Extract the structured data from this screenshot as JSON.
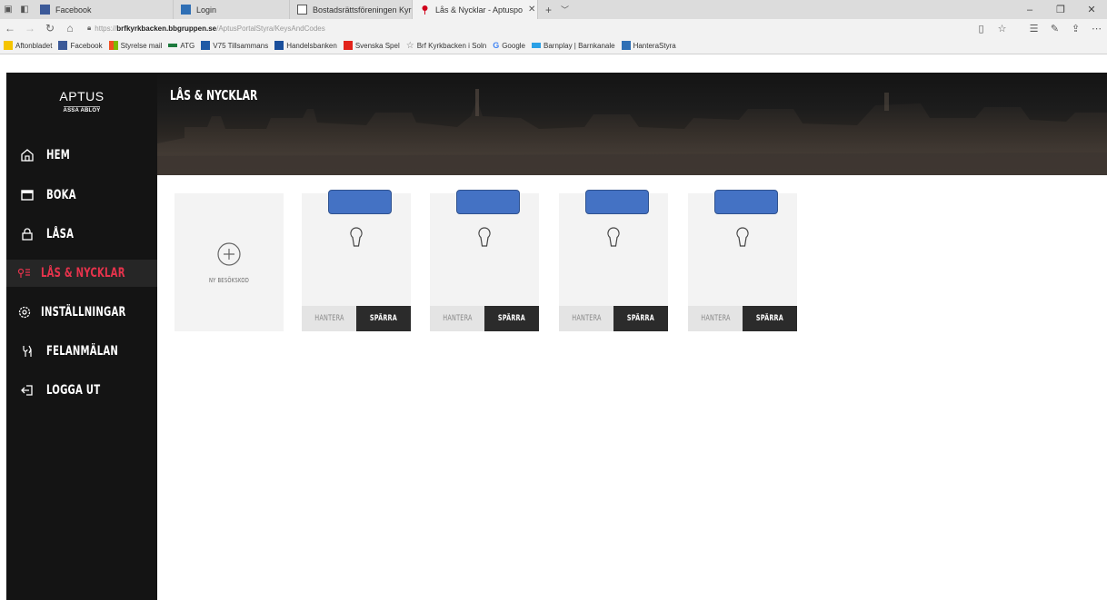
{
  "browser": {
    "tabs": [
      {
        "title": "Facebook",
        "icon": "facebook-icon",
        "color": "#3b5998",
        "active": false
      },
      {
        "title": "Login",
        "icon": "aptus-icon",
        "color": "#2f6fb5",
        "active": false
      },
      {
        "title": "Bostadsrättsföreningen Kyrl",
        "icon": "document-icon",
        "color": "#555555",
        "active": false
      },
      {
        "title": "Lås & Nycklar - Aptuspo",
        "icon": "pin-icon",
        "color": "#d0021b",
        "active": true
      }
    ],
    "url_prefix": "https://",
    "url_host": "brfkyrkbacken.bbgruppen.se",
    "url_path": "/AptusPortalStyra/KeysAndCodes",
    "bookmarks": [
      {
        "label": "Aftonbladet",
        "color": "#f5c400"
      },
      {
        "label": "Facebook",
        "color": "#3b5998"
      },
      {
        "label": "Styrelse mail",
        "color": "#f25022"
      },
      {
        "label": "ATG",
        "color": "#1d7a3d"
      },
      {
        "label": "V75 Tillsammans",
        "color": "#1f5aa6"
      },
      {
        "label": "Handelsbanken",
        "color": "#1a4f9c"
      },
      {
        "label": "Svenska Spel",
        "color": "#e2231a"
      },
      {
        "label": "Brf Kyrkbacken i Soln",
        "color": "#777777"
      },
      {
        "label": "Google",
        "color": "#4285f4"
      },
      {
        "label": "Barnplay | Barnkanale",
        "color": "#2aa0e6"
      },
      {
        "label": "HanteraStyra",
        "color": "#2f6fb5"
      }
    ]
  },
  "logo": {
    "main": "APTUS",
    "sub": "ASSA ABLOY"
  },
  "sidebar": {
    "items": [
      {
        "label": "HEM",
        "icon": "home-icon",
        "active": false
      },
      {
        "label": "BOKA",
        "icon": "calendar-icon",
        "active": false
      },
      {
        "label": "LÅSA",
        "icon": "lock-icon",
        "active": false
      },
      {
        "label": "LÅS & NYCKLAR",
        "icon": "keys-icon",
        "active": true
      },
      {
        "label": "INSTÄLLNINGAR",
        "icon": "gear-icon",
        "active": false
      },
      {
        "label": "FELANMÄLAN",
        "icon": "wrench-icon",
        "active": false
      },
      {
        "label": "LOGGA UT",
        "icon": "logout-icon",
        "active": false
      }
    ],
    "active_color": "#e6334c"
  },
  "page": {
    "title": "LÅS & NYCKLAR"
  },
  "new_card": {
    "label": "NY BESÖKSKOD",
    "icon": "add-circle-icon"
  },
  "key_cards": [
    {
      "icon": "key-icon",
      "manage_label": "HANTERA",
      "block_label": "SPÄRRA"
    },
    {
      "icon": "key-icon",
      "manage_label": "HANTERA",
      "block_label": "SPÄRRA"
    },
    {
      "icon": "key-icon",
      "manage_label": "HANTERA",
      "block_label": "SPÄRRA"
    },
    {
      "icon": "key-icon",
      "manage_label": "HANTERA",
      "block_label": "SPÄRRA"
    }
  ]
}
